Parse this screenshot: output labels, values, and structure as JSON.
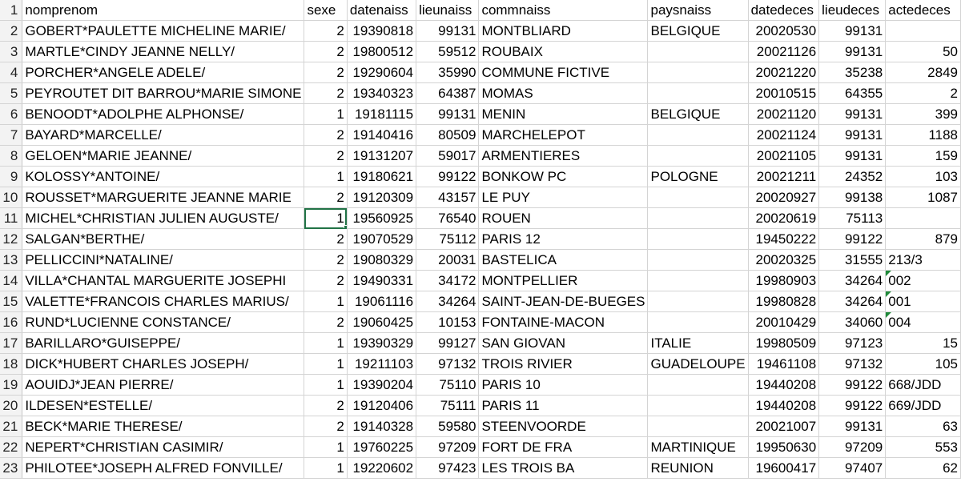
{
  "columns": [
    "nomprenom",
    "sexe",
    "datenaiss",
    "lieunaiss",
    "commnaiss",
    "paysnaiss",
    "datedeces",
    "lieudeces",
    "actedeces"
  ],
  "rows": [
    {
      "num": "1",
      "cells": [
        "nomprenom",
        "sexe",
        "datenaiss",
        "lieunaiss",
        "commnaiss",
        "paysnaiss",
        "datedeces",
        "lieudeces",
        "actedeces"
      ],
      "header": true
    },
    {
      "num": "2",
      "cells": [
        "GOBERT*PAULETTE MICHELINE MARIE/",
        "2",
        "19390818",
        "99131",
        "MONTBLIARD",
        "BELGIQUE",
        "20020530",
        "99131",
        ""
      ]
    },
    {
      "num": "3",
      "cells": [
        "MARTLE*CINDY JEANNE NELLY/",
        "2",
        "19800512",
        "59512",
        "ROUBAIX",
        "",
        "20021126",
        "99131",
        "50"
      ]
    },
    {
      "num": "4",
      "cells": [
        "PORCHER*ANGELE ADELE/",
        "2",
        "19290604",
        "35990",
        "COMMUNE FICTIVE",
        "",
        "20021220",
        "35238",
        "2849"
      ]
    },
    {
      "num": "5",
      "cells": [
        "PEYROUTET DIT BARROU*MARIE SIMONE",
        "2",
        "19340323",
        "64387",
        "MOMAS",
        "",
        "20010515",
        "64355",
        "2"
      ]
    },
    {
      "num": "6",
      "cells": [
        "BENOODT*ADOLPHE ALPHONSE/",
        "1",
        "19181115",
        "99131",
        "MENIN",
        "BELGIQUE",
        "20021120",
        "99131",
        "399"
      ]
    },
    {
      "num": "7",
      "cells": [
        "BAYARD*MARCELLE/",
        "2",
        "19140416",
        "80509",
        "MARCHELEPOT",
        "",
        "20021124",
        "99131",
        "1188"
      ]
    },
    {
      "num": "8",
      "cells": [
        "GELOEN*MARIE JEANNE/",
        "2",
        "19131207",
        "59017",
        "ARMENTIERES",
        "",
        "20021105",
        "99131",
        "159"
      ]
    },
    {
      "num": "9",
      "cells": [
        "KOLOSSY*ANTOINE/",
        "1",
        "19180621",
        "99122",
        "BONKOW PC",
        "POLOGNE",
        "20021211",
        "24352",
        "103"
      ]
    },
    {
      "num": "10",
      "cells": [
        "ROUSSET*MARGUERITE JEANNE MARIE",
        "2",
        "19120309",
        "43157",
        "LE PUY",
        "",
        "20020927",
        "99138",
        "1087"
      ]
    },
    {
      "num": "11",
      "cells": [
        "MICHEL*CHRISTIAN JULIEN AUGUSTE/",
        "1",
        "19560925",
        "76540",
        "ROUEN",
        "",
        "20020619",
        "75113",
        ""
      ],
      "active": true
    },
    {
      "num": "12",
      "cells": [
        "SALGAN*BERTHE/",
        "2",
        "19070529",
        "75112",
        "PARIS 12",
        "",
        "19450222",
        "99122",
        "879"
      ]
    },
    {
      "num": "13",
      "cells": [
        "PELLICCINI*NATALINE/",
        "2",
        "19080329",
        "20031",
        "BASTELICA",
        "",
        "20020325",
        "31555",
        "213/3"
      ]
    },
    {
      "num": "14",
      "cells": [
        "VILLA*CHANTAL MARGUERITE JOSEPHI",
        "2",
        "19490331",
        "34172",
        "MONTPELLIER",
        "",
        "19980903",
        "34264",
        "002"
      ],
      "flag": true
    },
    {
      "num": "15",
      "cells": [
        "VALETTE*FRANCOIS CHARLES MARIUS/",
        "1",
        "19061116",
        "34264",
        "SAINT-JEAN-DE-BUEGES",
        "",
        "19980828",
        "34264",
        "001"
      ],
      "flag": true
    },
    {
      "num": "16",
      "cells": [
        "RUND*LUCIENNE CONSTANCE/",
        "2",
        "19060425",
        "10153",
        "FONTAINE-MACON",
        "",
        "20010429",
        "34060",
        "004"
      ],
      "flag": true
    },
    {
      "num": "17",
      "cells": [
        "BARILLARO*GUISEPPE/",
        "1",
        "19390329",
        "99127",
        "SAN GIOVAN",
        "ITALIE",
        "19980509",
        "97123",
        "15"
      ]
    },
    {
      "num": "18",
      "cells": [
        "DICK*HUBERT CHARLES JOSEPH/",
        "1",
        "19211103",
        "97132",
        "TROIS RIVIER",
        "GUADELOUPE",
        "19461108",
        "97132",
        "105"
      ]
    },
    {
      "num": "19",
      "cells": [
        "AOUIDJ*JEAN PIERRE/",
        "1",
        "19390204",
        "75110",
        "PARIS 10",
        "",
        "19440208",
        "99122",
        "668/JDD"
      ]
    },
    {
      "num": "20",
      "cells": [
        "ILDESEN*ESTELLE/",
        "2",
        "19120406",
        "75111",
        "PARIS 11",
        "",
        "19440208",
        "99122",
        "669/JDD"
      ]
    },
    {
      "num": "21",
      "cells": [
        "BECK*MARIE THERESE/",
        "2",
        "19140328",
        "59580",
        "STEENVOORDE",
        "",
        "20021007",
        "99131",
        "63"
      ]
    },
    {
      "num": "22",
      "cells": [
        "NEPERT*CHRISTIAN CASIMIR/",
        "1",
        "19760225",
        "97209",
        "FORT DE FRA",
        "MARTINIQUE",
        "19950630",
        "97209",
        "553"
      ]
    },
    {
      "num": "23",
      "cells": [
        "PHILOTEE*JOSEPH ALFRED FONVILLE/",
        "1",
        "19220602",
        "97423",
        "LES TROIS BA",
        "REUNION",
        "19600417",
        "97407",
        "62"
      ]
    }
  ],
  "colors": {
    "selection": "#217346",
    "gridline": "#d4d4d4",
    "rowheader": "#f3f3f3"
  }
}
